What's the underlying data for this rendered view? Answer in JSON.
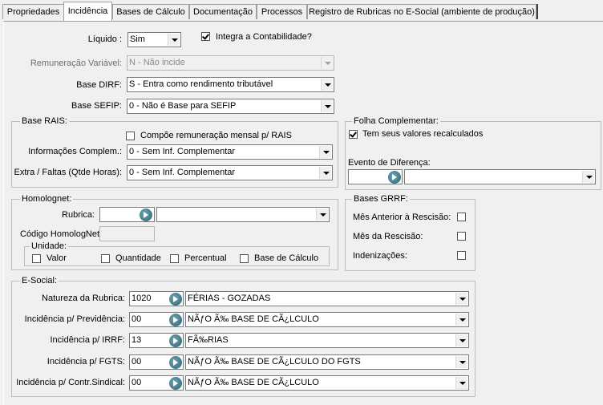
{
  "tabs": [
    {
      "label": "Propriedades"
    },
    {
      "label": "Incidência"
    },
    {
      "label": "Bases de Cálculo"
    },
    {
      "label": "Documentação"
    },
    {
      "label": "Processos"
    },
    {
      "label": "Registro de Rubricas no E-Social (ambiente de produção)"
    }
  ],
  "top": {
    "liquido_label": "Líquido :",
    "liquido_value": "Sim",
    "integra_label": "Integra a Contabilidade?",
    "remun_label": "Remuneração Variável:",
    "remun_value": "N - Não incide",
    "dirf_label": "Base DIRF:",
    "dirf_value": "S - Entra como rendimento tributável",
    "sefip_label": "Base SEFIP:",
    "sefip_value": "0 - Não é Base para SEFIP"
  },
  "rais": {
    "title": "Base RAIS:",
    "compoe_label": "Compõe remuneração mensal p/ RAIS",
    "info_label": "Informações Complem.:",
    "info_value": "0 - Sem Inf. Complementar",
    "extra_label": "Extra / Faltas (Qtde Horas):",
    "extra_value": "0 - Sem Inf. Complementar"
  },
  "folha": {
    "title": "Folha Complementar:",
    "recalc_label": "Tem seus valores recalculados",
    "evento_label": "Evento de Diferença:"
  },
  "homolognet": {
    "title": "Homolognet:",
    "rubrica_label": "Rubrica:",
    "codigo_label": "Código HomologNet",
    "unidade_title": "Unidade:",
    "valor_label": "Valor",
    "quantidade_label": "Quantidade",
    "percentual_label": "Percentual",
    "base_label": "Base de Cálculo"
  },
  "grrf": {
    "title": "Bases GRRF:",
    "mes_anterior_label": "Mês Anterior à Rescisão:",
    "mes_rescisao_label": "Mês da Rescisão:",
    "indenizacoes_label": "Indenizações:"
  },
  "esocial": {
    "title": "E-Social:",
    "rows": [
      {
        "label": "Natureza da Rubrica:",
        "code": "1020",
        "desc": "FÉRIAS - GOZADAS"
      },
      {
        "label": "Incidência p/ Previdência:",
        "code": "00",
        "desc": "NÃƒO Ã‰ BASE DE CÃ¿LCULO"
      },
      {
        "label": "Incidência p/ IRRF:",
        "code": "13",
        "desc": "FÃ‰RIAS"
      },
      {
        "label": "Incidência p/ FGTS:",
        "code": "00",
        "desc": "NÃƒO Ã‰ BASE DE CÃ¿LCULO DO FGTS"
      },
      {
        "label": "Incidência p/ Contr.Sindical:",
        "code": "00",
        "desc": "NÃƒO Ã‰ BASE DE CÃ¿LCULO"
      }
    ]
  }
}
